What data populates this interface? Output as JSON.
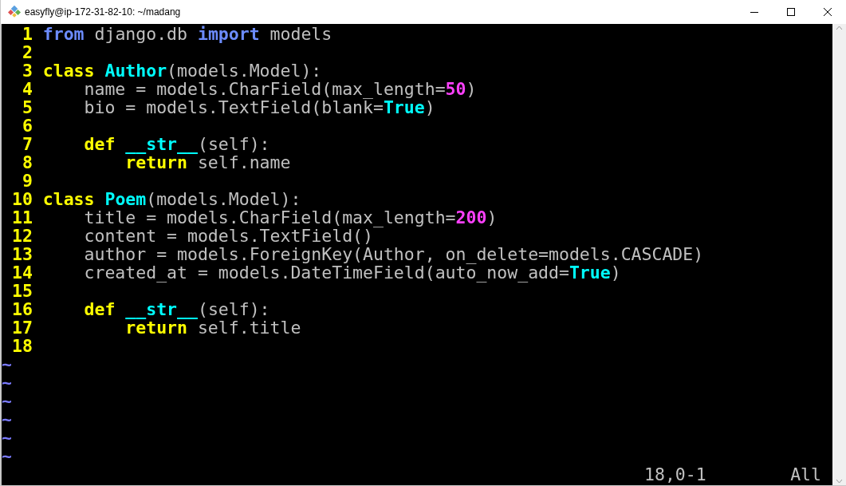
{
  "window": {
    "title": "easyfly@ip-172-31-82-10: ~/madang"
  },
  "lines": [
    {
      "number": "1",
      "tokens": [
        {
          "kind": "statement",
          "text": "from"
        },
        {
          "kind": "plain",
          "text": " django.db "
        },
        {
          "kind": "statement",
          "text": "import"
        },
        {
          "kind": "plain",
          "text": " models"
        }
      ]
    },
    {
      "number": "2"
    },
    {
      "number": "3",
      "tokens": [
        {
          "kind": "keyword",
          "text": "class"
        },
        {
          "kind": "name",
          "text": " Author"
        },
        {
          "kind": "plain",
          "text": "(models.Model):"
        }
      ]
    },
    {
      "number": "4",
      "tokens": [
        {
          "kind": "plain",
          "text": "    name = models.CharField(max_length="
        },
        {
          "kind": "number",
          "text": "50"
        },
        {
          "kind": "plain",
          "text": ")"
        }
      ]
    },
    {
      "number": "5",
      "tokens": [
        {
          "kind": "plain",
          "text": "    bio = models.TextField(blank="
        },
        {
          "kind": "name",
          "text": "True"
        },
        {
          "kind": "plain",
          "text": ")"
        }
      ]
    },
    {
      "number": "6"
    },
    {
      "number": "7",
      "tokens": [
        {
          "kind": "keyword",
          "text": "    def"
        },
        {
          "kind": "name",
          "text": " __str__"
        },
        {
          "kind": "plain",
          "text": "(self):"
        }
      ]
    },
    {
      "number": "8",
      "tokens": [
        {
          "kind": "keyword",
          "text": "        return"
        },
        {
          "kind": "plain",
          "text": " self.name"
        }
      ]
    },
    {
      "number": "9"
    },
    {
      "number": "10",
      "tokens": [
        {
          "kind": "keyword",
          "text": "class"
        },
        {
          "kind": "name",
          "text": " Poem"
        },
        {
          "kind": "plain",
          "text": "(models.Model):"
        }
      ]
    },
    {
      "number": "11",
      "tokens": [
        {
          "kind": "plain",
          "text": "    title = models.CharField(max_length="
        },
        {
          "kind": "number",
          "text": "200"
        },
        {
          "kind": "plain",
          "text": ")"
        }
      ]
    },
    {
      "number": "12",
      "tokens": [
        {
          "kind": "plain",
          "text": "    content = models.TextField()"
        }
      ]
    },
    {
      "number": "13",
      "tokens": [
        {
          "kind": "plain",
          "text": "    author = models.ForeignKey(Author, on_delete=models.CASCADE)"
        }
      ]
    },
    {
      "number": "14",
      "tokens": [
        {
          "kind": "plain",
          "text": "    created_at = models.DateTimeField(auto_now_add="
        },
        {
          "kind": "name",
          "text": "True"
        },
        {
          "kind": "plain",
          "text": ")"
        }
      ]
    },
    {
      "number": "15"
    },
    {
      "number": "16",
      "tokens": [
        {
          "kind": "keyword",
          "text": "    def"
        },
        {
          "kind": "name",
          "text": " __str__"
        },
        {
          "kind": "plain",
          "text": "(self):"
        }
      ]
    },
    {
      "number": "17",
      "tokens": [
        {
          "kind": "keyword",
          "text": "        return"
        },
        {
          "kind": "plain",
          "text": " self.title"
        }
      ]
    },
    {
      "number": "18"
    }
  ],
  "tildes": [
    "~",
    "~",
    "~",
    "~",
    "~",
    "~"
  ],
  "status_line": {
    "position": "18,0-1",
    "scroll": "All"
  }
}
